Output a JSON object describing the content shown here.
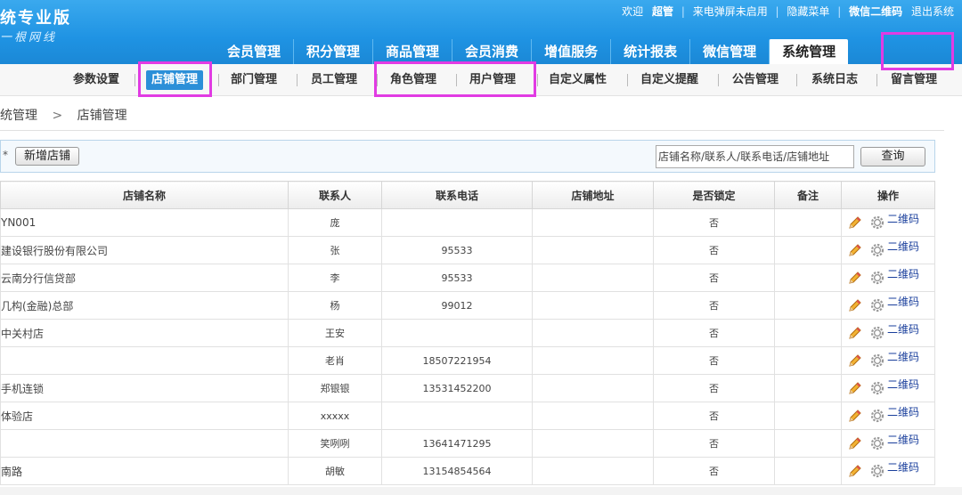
{
  "header": {
    "title": "统专业版",
    "subtitle": "一根网线",
    "links": {
      "welcome": "欢迎",
      "user": "超管",
      "screen": "来电弹屏未启用",
      "hide_menu": "隐藏菜单",
      "wechat_qr": "微信二维码",
      "logout": "退出系统"
    }
  },
  "main_nav": [
    {
      "label": "会员管理"
    },
    {
      "label": "积分管理"
    },
    {
      "label": "商品管理"
    },
    {
      "label": "会员消费"
    },
    {
      "label": "增值服务"
    },
    {
      "label": "统计报表"
    },
    {
      "label": "微信管理"
    },
    {
      "label": "系统管理"
    }
  ],
  "sub_nav": [
    {
      "label": "参数设置"
    },
    {
      "label": "店铺管理"
    },
    {
      "label": "部门管理"
    },
    {
      "label": "员工管理"
    },
    {
      "label": "角色管理"
    },
    {
      "label": "用户管理"
    },
    {
      "label": "自定义属性"
    },
    {
      "label": "自定义提醒"
    },
    {
      "label": "公告管理"
    },
    {
      "label": "系统日志"
    },
    {
      "label": "留言管理"
    }
  ],
  "breadcrumb": {
    "parent": "统管理",
    "arrow": ">",
    "current": "店铺管理"
  },
  "toolbar": {
    "star": "*",
    "add_label": "新增店铺",
    "search_placeholder": "店铺名称/联系人/联系电话/店铺地址",
    "search_label": "查询"
  },
  "table": {
    "headers": [
      "店铺名称",
      "联系人",
      "联系电话",
      "店铺地址",
      "是否锁定",
      "备注",
      "操作"
    ],
    "rows": [
      {
        "name": "YN001",
        "contact": "庞",
        "phone": "",
        "address": "",
        "locked": "否",
        "remark": "",
        "qr": "二维码"
      },
      {
        "name": "建设银行股份有限公司",
        "contact": "张",
        "phone": "95533",
        "address": "",
        "locked": "否",
        "remark": "",
        "qr": "二维码"
      },
      {
        "name": "云南分行信贷部",
        "contact": "李",
        "phone": "95533",
        "address": "",
        "locked": "否",
        "remark": "",
        "qr": "二维码"
      },
      {
        "name": "几构(金融)总部",
        "contact": "杨",
        "phone": "99012",
        "address": "",
        "locked": "否",
        "remark": "",
        "qr": "二维码"
      },
      {
        "name": "中关村店",
        "contact": "王安",
        "phone": "",
        "address": "",
        "locked": "否",
        "remark": "",
        "qr": "二维码"
      },
      {
        "name": "",
        "contact": "老肖",
        "phone": "18507221954",
        "address": "",
        "locked": "否",
        "remark": "",
        "qr": "二维码"
      },
      {
        "name": "手机连锁",
        "contact": "郑银银",
        "phone": "13531452200",
        "address": "",
        "locked": "否",
        "remark": "",
        "qr": "二维码"
      },
      {
        "name": "体验店",
        "contact": "xxxxx",
        "phone": "",
        "address": "",
        "locked": "否",
        "remark": "",
        "qr": "二维码"
      },
      {
        "name": "",
        "contact": "笑咧咧",
        "phone": "13641471295",
        "address": "",
        "locked": "否",
        "remark": "",
        "qr": "二维码"
      },
      {
        "name": "南路",
        "contact": "胡敏",
        "phone": "13154854564",
        "address": "",
        "locked": "否",
        "remark": "",
        "qr": "二维码"
      }
    ]
  },
  "colors": {
    "header_blue": "#1f93e3",
    "active_sub": "#2b8fd8",
    "highlight": "#e13be3",
    "qr_link": "#1a3f9c"
  },
  "icons": {
    "edit": "pencil-icon",
    "settings": "gear-icon"
  }
}
